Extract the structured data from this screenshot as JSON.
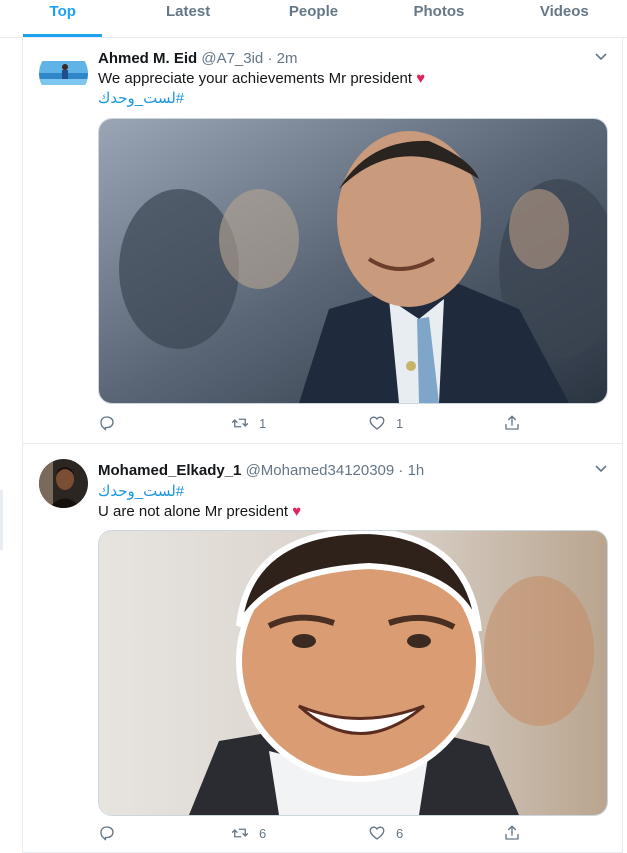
{
  "tabs": [
    {
      "label": "Top",
      "active": true
    },
    {
      "label": "Latest",
      "active": false
    },
    {
      "label": "People",
      "active": false
    },
    {
      "label": "Photos",
      "active": false
    },
    {
      "label": "Videos",
      "active": false
    }
  ],
  "tweets": [
    {
      "name": "Ahmed M. Eid",
      "handle": "@A7_3id",
      "separator": "·",
      "time": "2m",
      "text": "We appreciate your achievements Mr president",
      "hashtag": "#لست_وحدك",
      "heart_emoji": "♥",
      "retweets": "1",
      "likes": "1",
      "media_icon": "photo-of-president-smiling",
      "avatar_icon": "avatar-sea-photo"
    },
    {
      "name": "Mohamed_Elkady_1",
      "handle": "@Mohamed34120309",
      "separator": "·",
      "time": "1h",
      "hashtag": "#لست_وحدك",
      "text": "U are not alone Mr president",
      "heart_emoji": "♥",
      "retweets": "6",
      "likes": "6",
      "media_icon": "cartoon-portrait-of-president",
      "avatar_icon": "avatar-person-photo"
    }
  ],
  "colors": {
    "accent": "#1da1f2",
    "link": "#1b95e0",
    "secondary_text": "#657786",
    "heart": "#e0245e",
    "border": "#e6ecf0"
  }
}
